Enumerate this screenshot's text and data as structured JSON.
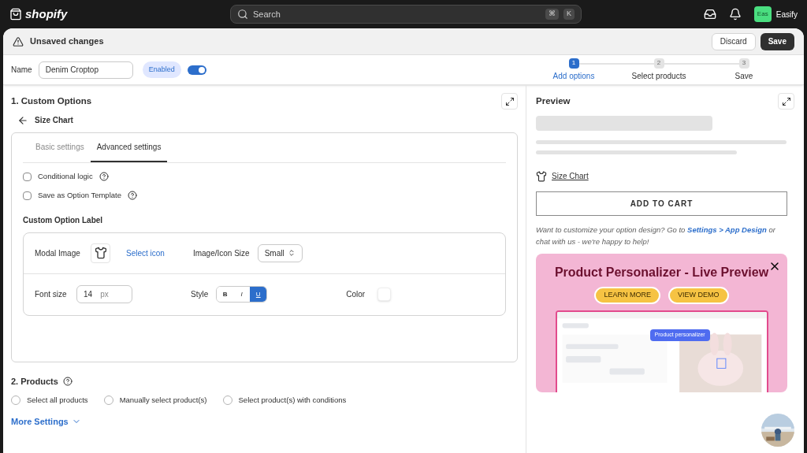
{
  "topbar": {
    "brand": "shopify",
    "search": {
      "placeholder": "Search",
      "keys": [
        "⌘",
        "K"
      ]
    },
    "store": {
      "avatar": "Eas",
      "name": "Easify"
    }
  },
  "save_bar": {
    "title": "Unsaved changes",
    "buttons": [
      {
        "label": "Discard",
        "kind": "secondary"
      },
      {
        "label": "Save",
        "kind": "primary"
      }
    ]
  },
  "name_row": {
    "label": "Name",
    "value": "Denim Croptop",
    "badge": "Enabled",
    "on": true
  },
  "steps": [
    {
      "number": "1",
      "label": "Add options",
      "selected": true
    },
    {
      "number": "2",
      "label": "Select products",
      "selected": false
    },
    {
      "number": "3",
      "label": "Save",
      "selected": false
    }
  ],
  "custom_options": {
    "title": "1. Custom Options",
    "back": "Size Chart",
    "tabs": [
      {
        "label": "Basic settings",
        "selected": false
      },
      {
        "label": "Advanced settings",
        "selected": true
      }
    ],
    "checkboxes": [
      {
        "label": "Conditional logic",
        "checked": false
      },
      {
        "label": "Save as Option Template",
        "checked": false
      }
    ],
    "label_section": {
      "title": "Custom Option Label",
      "modal_image": "Modal Image",
      "select_icon": "Select icon",
      "size_label": "Image/Icon Size",
      "size_value": "Small",
      "font_size_label": "Font size",
      "font_size": "14",
      "unit": "px",
      "style_label": "Style",
      "styles": [
        {
          "label": "B",
          "selected": false
        },
        {
          "label": "I",
          "selected": false
        },
        {
          "label": "U",
          "selected": true
        }
      ],
      "color_label": "Color"
    }
  },
  "products": {
    "title": "2. Products",
    "options": [
      {
        "label": "Select all products",
        "selected": false
      },
      {
        "label": "Manually select product(s)",
        "selected": false
      },
      {
        "label": "Select product(s) with conditions",
        "selected": false
      }
    ],
    "more": "More Settings"
  },
  "preview": {
    "title": "Preview",
    "size_chart": "Size Chart",
    "add_to_cart": "ADD TO CART",
    "note_parts": {
      "before": "Want to customize your option design? Go to ",
      "link": "Settings > App Design",
      "after": " or chat with us - we're happy to help!"
    },
    "banner": {
      "title": "Product Personalizer - Live Preview",
      "buttons": [
        "LEARN MORE",
        "VIEW DEMO"
      ],
      "tag": "Product personalizer"
    }
  }
}
